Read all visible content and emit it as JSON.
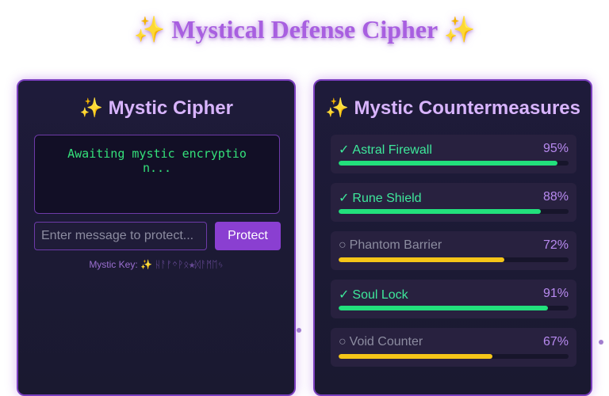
{
  "page": {
    "title": "✨ Mystical Defense Cipher ✨"
  },
  "cipher": {
    "title": "✨ Mystic Cipher",
    "output": "Awaiting mystic encryption...",
    "input_placeholder": "Enter message to protect...",
    "input_value": "",
    "button_label": "Protect",
    "key_label": "Mystic Key:",
    "key_value": "✨ ᚺᚨᚠᛜᚹᛟ★ᛞᚨᛗᛖᛃ"
  },
  "countermeasures": {
    "title": "✨ Mystic Countermeasures",
    "items": [
      {
        "status": "✓",
        "name": "Astral Firewall",
        "percent": "95%",
        "level": 0.95,
        "active": true
      },
      {
        "status": "✓",
        "name": "Rune Shield",
        "percent": "88%",
        "level": 0.88,
        "active": true
      },
      {
        "status": "○",
        "name": "Phantom Barrier",
        "percent": "72%",
        "level": 0.72,
        "active": false
      },
      {
        "status": "✓",
        "name": "Soul Lock",
        "percent": "91%",
        "level": 0.91,
        "active": true
      },
      {
        "status": "○",
        "name": "Void Counter",
        "percent": "67%",
        "level": 0.67,
        "active": false
      }
    ]
  },
  "colors": {
    "active": "#22e07c",
    "inactive": "#f5c518",
    "accent": "#a85fe0"
  }
}
